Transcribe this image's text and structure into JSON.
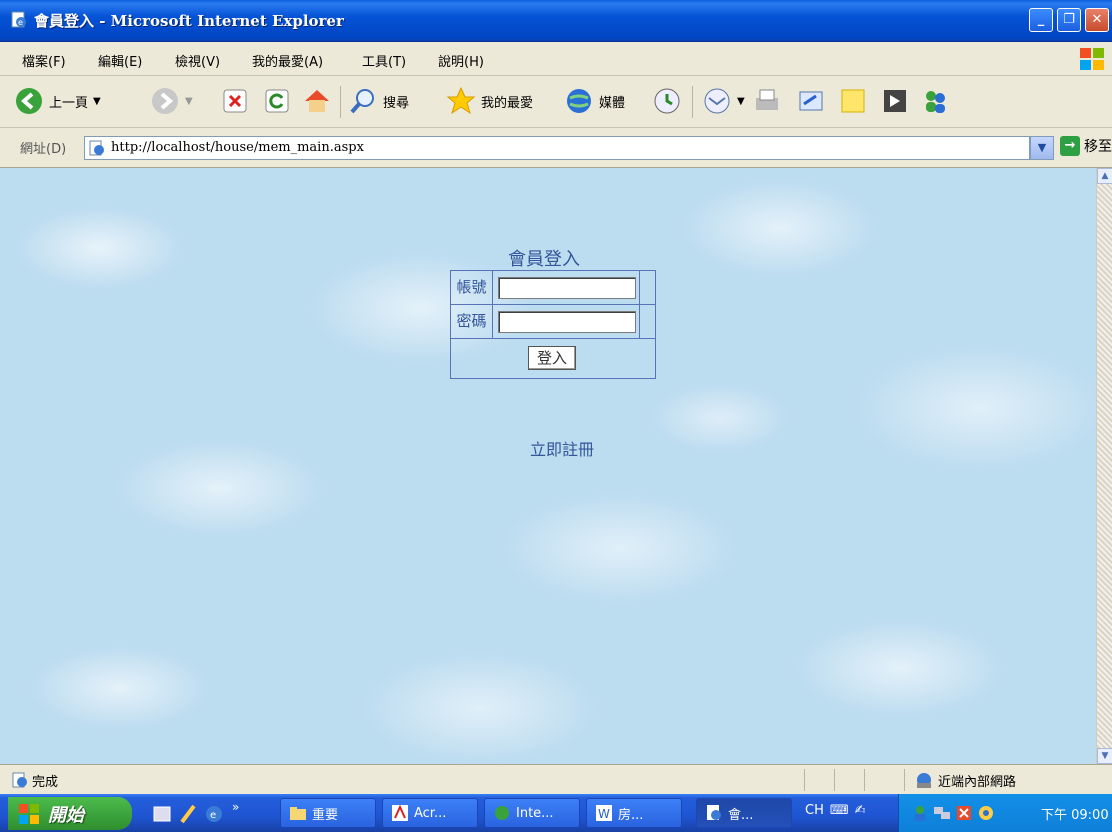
{
  "window": {
    "title": "會員登入 - Microsoft Internet Explorer"
  },
  "menu": {
    "items": [
      "檔案(F)",
      "編輯(E)",
      "檢視(V)",
      "我的最愛(A)",
      "工具(T)",
      "說明(H)"
    ]
  },
  "toolbar": {
    "back_label": "上一頁",
    "search_label": "搜尋",
    "favorites_label": "我的最愛",
    "media_label": "媒體"
  },
  "address": {
    "label": "網址(D)",
    "url": "http://localhost/house/mem_main.aspx",
    "go_label": "移至"
  },
  "page": {
    "login_title": "會員登入",
    "account_label": "帳號",
    "password_label": "密碼",
    "account_value": "",
    "password_value": "",
    "login_button": "登入",
    "register_link": "立即註冊"
  },
  "status": {
    "text": "完成",
    "zone": "近端內部網路"
  },
  "taskbar": {
    "start_label": "開始",
    "tasks": [
      "重要",
      "Acr...",
      "Inte...",
      "房...",
      "會..."
    ],
    "language": "CH",
    "clock": "下午 09:00"
  },
  "colors": {
    "page_text": "#335599",
    "table_border": "#5a73b8",
    "background": "#bcdcf0"
  }
}
